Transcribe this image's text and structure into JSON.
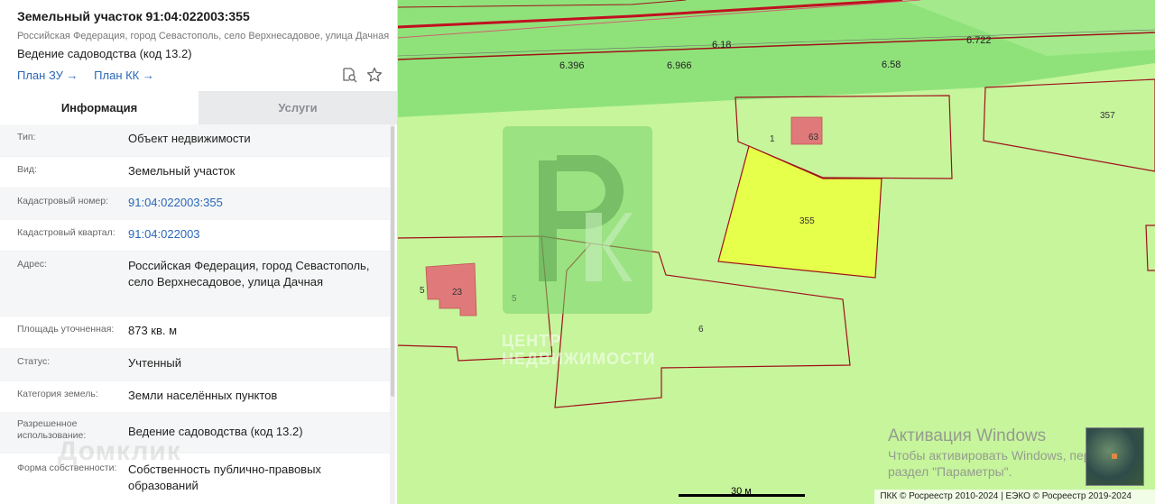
{
  "panel": {
    "title": "Земельный участок 91:04:022003:355",
    "address_line": "Российская Федерация, город Севастополь, село Верхнесадовое, улица Дачная",
    "use_line": "Ведение садоводства (код 13.2)",
    "links": [
      {
        "label": "План ЗУ →"
      },
      {
        "label": "План КК →"
      }
    ],
    "icons": [
      "search-document-icon",
      "star-icon"
    ],
    "tabs": [
      {
        "label": "Информация",
        "active": true
      },
      {
        "label": "Услуги",
        "active": false
      }
    ],
    "rows": [
      {
        "label": "Тип:",
        "value": "Объект недвижимости",
        "link": false
      },
      {
        "label": "Вид:",
        "value": "Земельный участок",
        "link": false
      },
      {
        "label": "Кадастровый номер:",
        "value": "91:04:022003:355",
        "link": true
      },
      {
        "label": "Кадастровый квартал:",
        "value": "91:04:022003",
        "link": true
      },
      {
        "label": "Адрес:",
        "value": "Российская Федерация, город Севастополь, село Верхнесадовое, улица Дачная",
        "link": false
      },
      {
        "label": "Площадь уточненная:",
        "value": "873 кв. м",
        "link": false
      },
      {
        "label": "Статус:",
        "value": "Учтенный",
        "link": false
      },
      {
        "label": "Категория земель:",
        "value": "Земли населённых пунктов",
        "link": false
      },
      {
        "label": "Разрешенное использование:",
        "value": "Ведение садоводства (код 13.2)",
        "link": false
      },
      {
        "label": "Форма собственности:",
        "value": "Собственность публично-правовых образований",
        "link": false
      }
    ],
    "watermark": "Домклик"
  },
  "map": {
    "dimension_labels": [
      "6.18",
      "6.722",
      "6.396",
      "6.966",
      "6.58"
    ],
    "plot_labels": [
      "1",
      "63",
      "357",
      "355",
      "5",
      "23",
      "5",
      "6"
    ],
    "watermark_brand": "РК",
    "watermark_text": [
      "ЦЕНТР",
      "НЕДВИЖИМОСТИ"
    ],
    "windows_activation": {
      "title": "Активация Windows",
      "line1": "Чтобы активировать Windows, перейдите в",
      "line2": "раздел \"Параметры\"."
    },
    "scale_label": "30 м",
    "copyright": "ПКК © Росреестр 2010-2024 | ЕЭКО © Росреестр 2019-2024",
    "colors": {
      "background": "#c6f59c",
      "road_band": "#8fe27a",
      "parcel_border": "#a0101a",
      "selected_fill": "#e6ff4a",
      "building_fill": "#e07a7a"
    }
  }
}
